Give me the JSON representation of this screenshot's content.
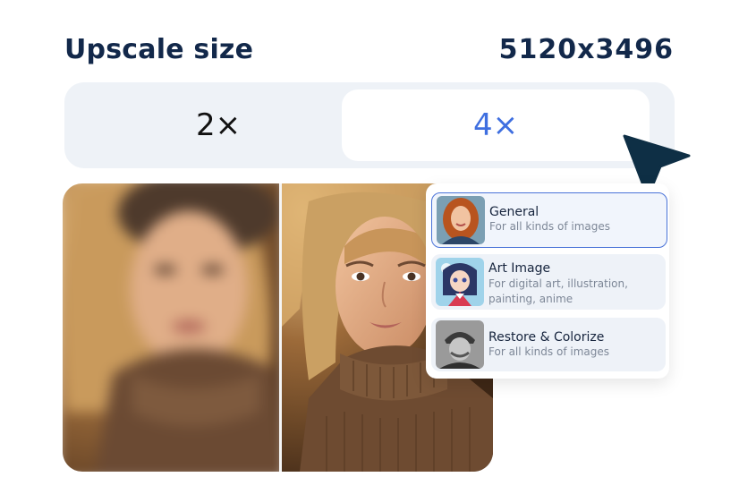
{
  "header": {
    "title": "Upscale size",
    "size_value": "5120x3496"
  },
  "scale": {
    "options": [
      {
        "label": "2×",
        "selected": false
      },
      {
        "label": "4×",
        "selected": true
      }
    ],
    "accent": "#3f6fe0"
  },
  "models": [
    {
      "title": "General",
      "description": "For all kinds of images",
      "selected": true
    },
    {
      "title": "Art Image",
      "description": "For digital art, illustration, painting, anime",
      "selected": false
    },
    {
      "title": "Restore & Colorize",
      "description": "For all kinds of images",
      "selected": false
    }
  ],
  "colors": {
    "title": "#12284a",
    "cursor": "#0e2f45",
    "selected_border": "#4a73d8"
  },
  "icons": {
    "cursor": "pointer-arrow-icon"
  }
}
